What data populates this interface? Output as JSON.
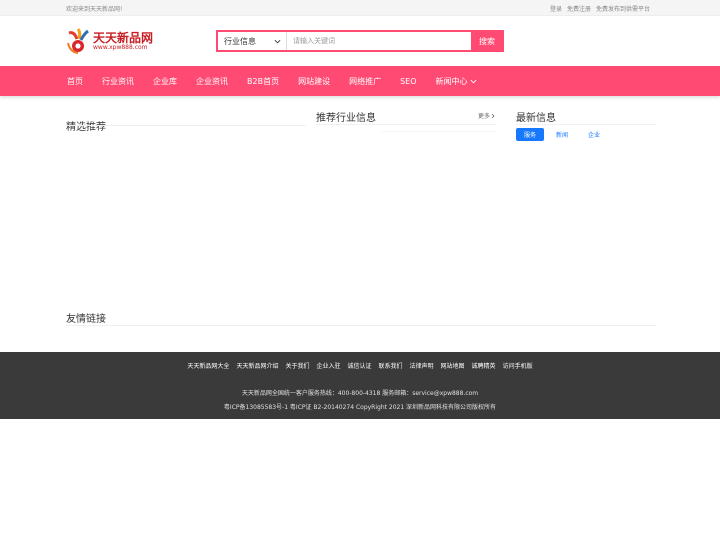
{
  "topbar": {
    "welcome": "欢迎来到天天新品网!",
    "login": "登录",
    "register": "免费注册",
    "free_post": "免费发布到供需平台"
  },
  "logo": {
    "brand": "天天新品网",
    "domain": "www.xpw888.com"
  },
  "search": {
    "category": "行业信息",
    "placeholder": "请输入关键词",
    "button": "搜索"
  },
  "nav": {
    "items": [
      "首页",
      "行业资讯",
      "企业库",
      "企业资讯",
      "B2B首页",
      "网站建设",
      "网络推广",
      "SEO",
      "新闻中心"
    ]
  },
  "sections": {
    "featured": "精选推荐",
    "recommended": "推荐行业信息",
    "more": "更多",
    "latest": "最新信息",
    "friend_links": "友情链接"
  },
  "latest_tabs": [
    "服务",
    "新闻",
    "企业"
  ],
  "footer": {
    "links": [
      "天天新品网大全",
      "天天新品网介绍",
      "关于我们",
      "企业入驻",
      "诚信认证",
      "联系我们",
      "法律声明",
      "网站地图",
      "诚聘精英",
      "访问手机版"
    ],
    "hotline": "天天新品网全国统一客户服务热线：400-800-4318 服务邮箱：service@xpw888.com",
    "copyright": "粤ICP备13085583号-1 粤ICP证 B2-20140274 CopyRight 2021 深圳新品网科技有限公司版权所有"
  },
  "colors": {
    "accent": "#ff4b73",
    "tab_blue": "#1677ff",
    "footer_bg": "#3a3a3a",
    "logo_red": "#c71e23"
  }
}
